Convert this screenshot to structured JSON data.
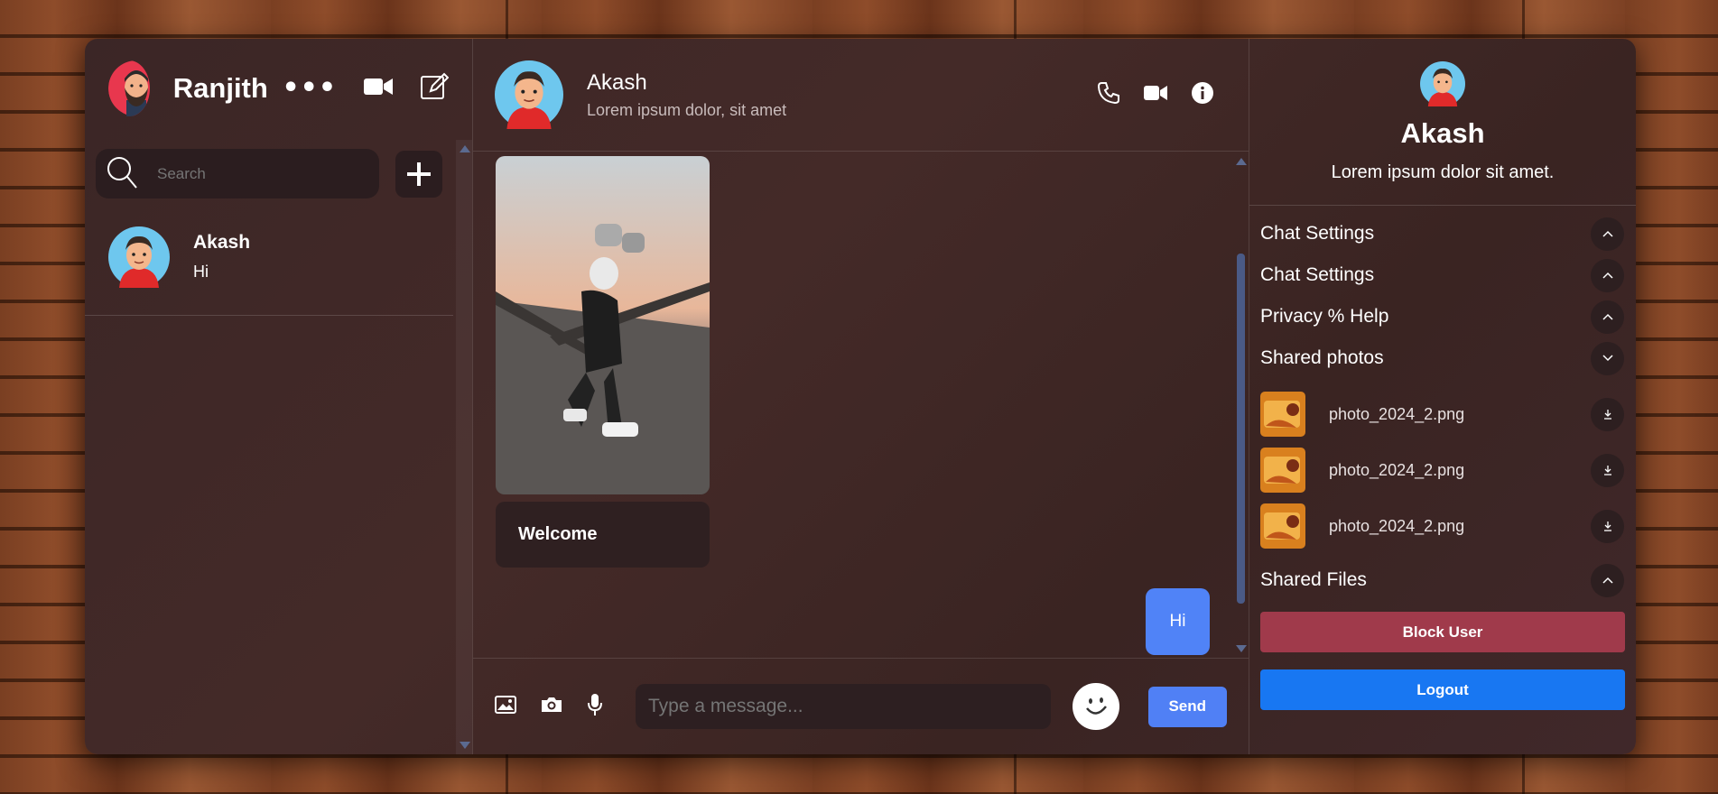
{
  "sidebar": {
    "user_name": "Ranjith",
    "search_placeholder": "Search",
    "chats": [
      {
        "name": "Akash",
        "last_message": "Hi"
      }
    ]
  },
  "chat": {
    "contact_name": "Akash",
    "contact_status": "Lorem ipsum dolor, sit amet",
    "messages": {
      "received_text": "Welcome",
      "sent_text": "Hi"
    },
    "composer": {
      "placeholder": "Type a message...",
      "send_label": "Send"
    }
  },
  "details": {
    "name": "Akash",
    "description": "Lorem ipsum dolor sit amet.",
    "sections": [
      {
        "title": "Chat Settings"
      },
      {
        "title": "Chat Settings"
      },
      {
        "title": "Privacy % Help"
      },
      {
        "title": "Shared photos"
      }
    ],
    "shared_photos": [
      {
        "file": "photo_2024_2.png"
      },
      {
        "file": "photo_2024_2.png"
      },
      {
        "file": "photo_2024_2.png"
      }
    ],
    "shared_files_title": "Shared Files",
    "block_label": "Block User",
    "logout_label": "Logout"
  },
  "colors": {
    "send": "#5080f5",
    "block": "#a03a4b",
    "logout": "#1877f2",
    "scroll_thumb": "#4a5a86"
  }
}
